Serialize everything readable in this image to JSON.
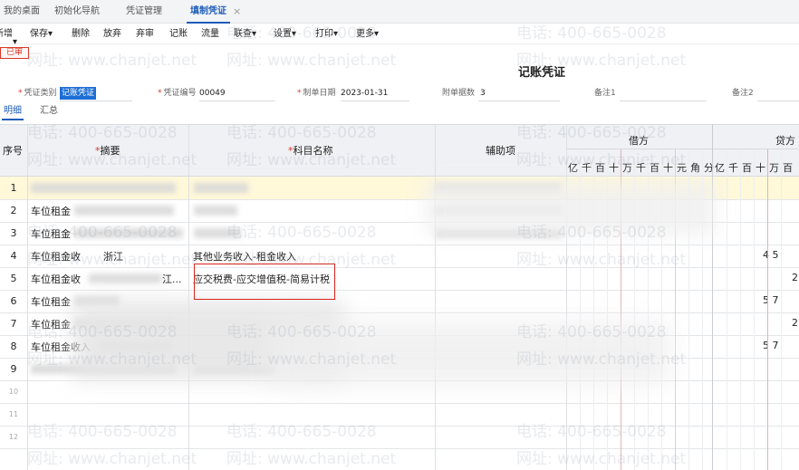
{
  "tabs": [
    {
      "label": "我的桌面"
    },
    {
      "label": "初始化导航"
    },
    {
      "label": "凭证管理"
    },
    {
      "label": "填制凭证"
    }
  ],
  "tab_close_glyph": "×",
  "toolbar": {
    "items": [
      "新增",
      "保存",
      "删除",
      "放弃",
      "弃审",
      "记账",
      "流量",
      "联查",
      "设置",
      "打印",
      "更多"
    ]
  },
  "status_badge": "已审",
  "doc_title": "记账凭证",
  "fields": {
    "voucher_type_label": "凭证类别",
    "voucher_type_value": "记账凭证",
    "voucher_no_label": "凭证编号",
    "voucher_no_value": "00049",
    "date_label": "制单日期",
    "date_value": "2023-01-31",
    "attach_label": "附单据数",
    "attach_value": "3",
    "note1_label": "备注1",
    "note2_label": "备注2"
  },
  "subtabs": [
    "明细",
    "汇总"
  ],
  "grid": {
    "col_seq": "序号",
    "col_summary": "摘要",
    "col_account": "科目名称",
    "col_aux": "辅助项",
    "col_debit": "借方",
    "col_credit": "贷方",
    "digits_debit": [
      "亿",
      "千",
      "百",
      "十",
      "万",
      "千",
      "百",
      "十",
      "元",
      "角",
      "分"
    ],
    "digits_credit": [
      "亿",
      "千",
      "百",
      "十",
      "万",
      "百"
    ],
    "rows": [
      {
        "n": "1",
        "summary": "",
        "account": "",
        "credit": ""
      },
      {
        "n": "2",
        "summary": "车位租金",
        "account": "",
        "credit": ""
      },
      {
        "n": "3",
        "summary": "车位租金",
        "account": "",
        "credit": ""
      },
      {
        "n": "4",
        "summary": "车位租金收",
        "summary2": "浙江",
        "account": "其他业务收入-租金收入",
        "credit": "4  5"
      },
      {
        "n": "5",
        "summary": "车位租金收",
        "summary2": "江...",
        "account": "应交税费-应交增值税-简易计税",
        "credit": "2"
      },
      {
        "n": "6",
        "summary": "车位租金",
        "account": "",
        "credit": "5  7"
      },
      {
        "n": "7",
        "summary": "车位租金",
        "account": "",
        "credit": "2"
      },
      {
        "n": "8",
        "summary": "车位租金收入",
        "account": "",
        "credit": "5  7"
      },
      {
        "n": "9",
        "summary": "",
        "account": "",
        "credit": ""
      },
      {
        "n": "10",
        "summary": "",
        "account": "",
        "credit": ""
      },
      {
        "n": "11",
        "summary": "",
        "account": "",
        "credit": ""
      },
      {
        "n": "12",
        "summary": "",
        "account": "",
        "credit": ""
      }
    ]
  },
  "watermark": {
    "phone": "电话: 400-665-0028",
    "site": "网址: www.chanjet.net"
  },
  "colors": {
    "accent": "#1d5db8",
    "alert": "#d9231a",
    "highlight_row": "#fff8d9"
  }
}
